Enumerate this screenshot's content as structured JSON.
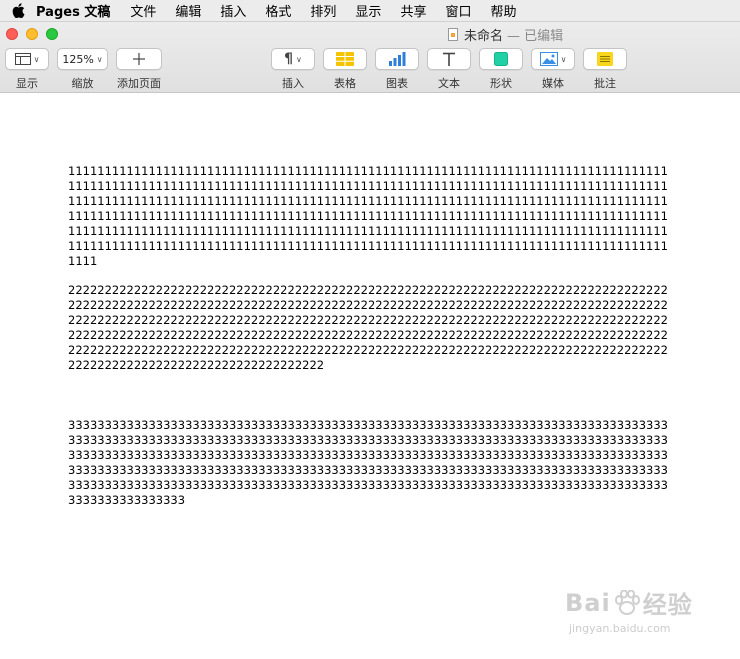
{
  "menubar": {
    "app_name": "Pages 文稿",
    "items": [
      "文件",
      "编辑",
      "插入",
      "格式",
      "排列",
      "显示",
      "共享",
      "窗口",
      "帮助"
    ]
  },
  "window": {
    "doc_name": "未命名",
    "doc_status": "— 已编辑"
  },
  "toolbar": {
    "view_label": "显示",
    "zoom_value": "125%",
    "zoom_label": "缩放",
    "add_page_label": "添加页面",
    "insert_label": "插入",
    "table_label": "表格",
    "chart_label": "图表",
    "text_label": "文本",
    "shape_label": "形状",
    "media_label": "媒体",
    "comment_label": "批注"
  },
  "document": {
    "paragraphs": [
      "1111111111111111111111111111111111111111111111111111111111111111111111111111111111111111111111111111111111111111111111111111111111111111111111111111111111111111111111111111111111111111111111111111111111111111111111111111111111111111111111111111111111111111111111111111111111111111111111111111111111111111111111111111111111111111111111111111111111111111111111111111111111111111111111111111111111111111111111111111111111111111111111111111111111111111111111111111111111111111111111111111111111111111",
      "2222222222222222222222222222222222222222222222222222222222222222222222222222222222222222222222222222222222222222222222222222222222222222222222222222222222222222222222222222222222222222222222222222222222222222222222222222222222222222222222222222222222222222222222222222222222222222222222222222222222222222222222222222222222222222222222222222222222222222222222222222222222222222222222222222222222222222222222222222222222222222222222222222222222222",
      "333333333333333333333333333333333333333333333333333333333333333333333333333333333333333333333333333333333333333333333333333333333333333333333333333333333333333333333333333333333333333333333333333333333333333333333333333333333333333333333333333333333333333333333333333333333333333333333333333333333333333333333333333333333333333333333333333333333333333333333333333333333333333333333333333333333333333333333333333333333333333333"
    ]
  },
  "watermark": {
    "brand_left": "Bai",
    "brand_right": "经验",
    "url": "jingyan.baidu.com"
  },
  "colors": {
    "close": "#fe5f57",
    "minimize": "#febc2e",
    "maximize": "#28c840",
    "table_icon": "#f5c400",
    "chart_icon": "#2f7fd8",
    "shape_icon": "#1fd1a4",
    "media_icon": "#3b8ee6",
    "comment_icon": "#f7d61d"
  }
}
